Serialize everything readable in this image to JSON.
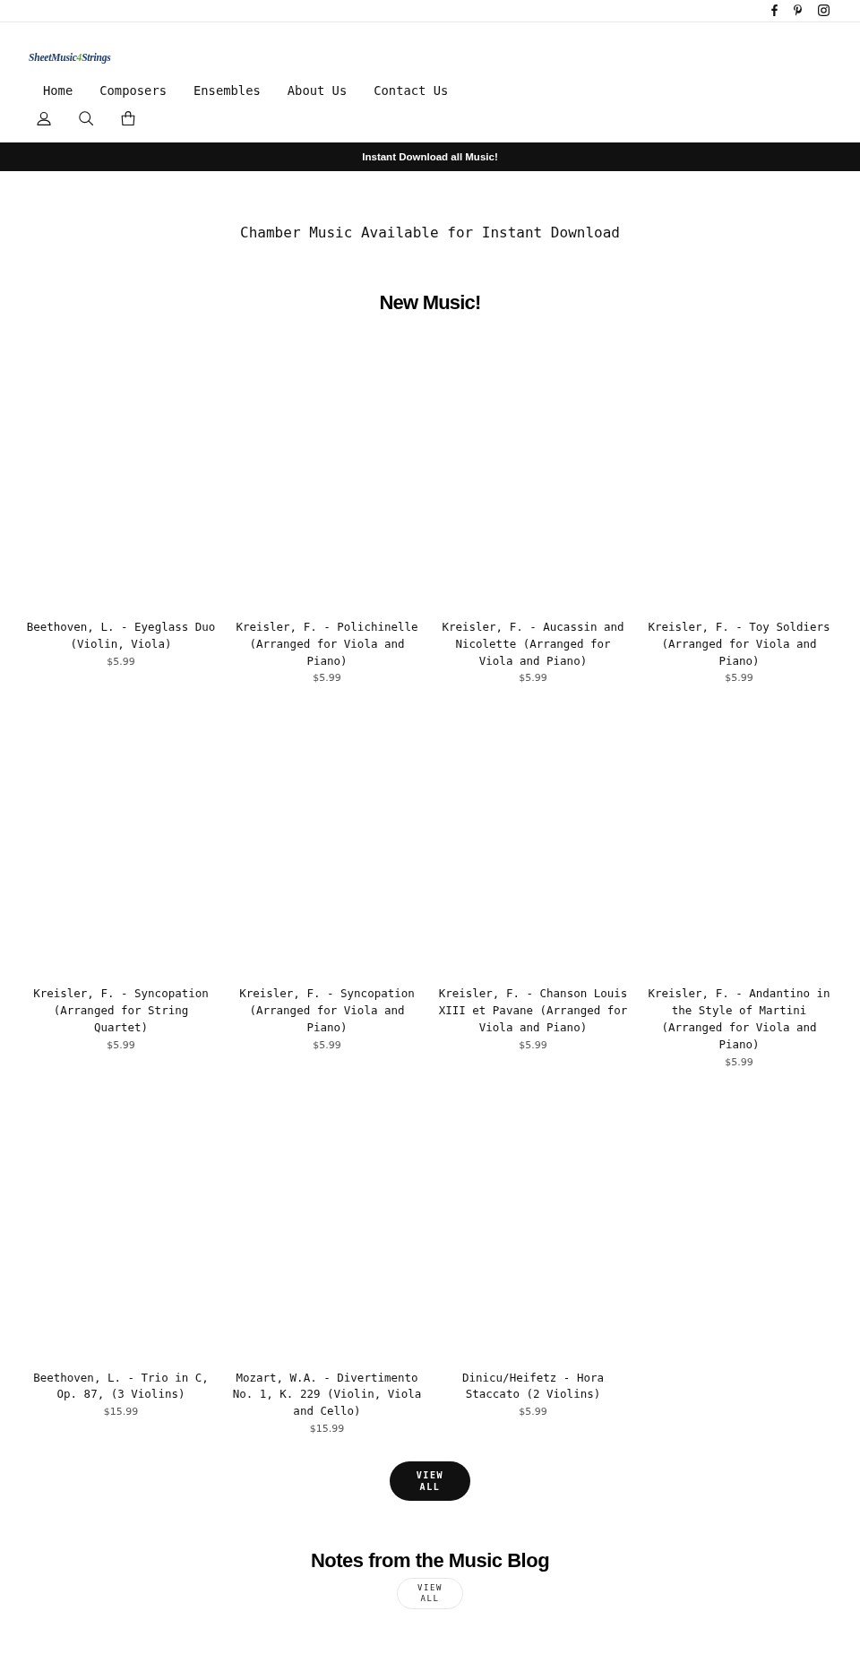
{
  "logo": {
    "segments": [
      {
        "text": "SheetMusic",
        "color": "#1d3b66"
      },
      {
        "text": "4",
        "color": "#6aaa3a"
      },
      {
        "text": "Strings",
        "color": "#1d3b66"
      }
    ]
  },
  "nav": [
    "Home",
    "Composers",
    "Ensembles",
    "About Us",
    "Contact Us"
  ],
  "announcement": "Instant Download all Music!",
  "tagline": "Chamber Music Available for Instant Download",
  "new_music": {
    "title": "New Music!",
    "products": [
      {
        "title": "Beethoven, L. - Eyeglass Duo (Violin, Viola)",
        "price": "$5.99"
      },
      {
        "title": "Kreisler, F. - Polichinelle (Arranged for Viola and Piano)",
        "price": "$5.99"
      },
      {
        "title": "Kreisler, F. - Aucassin and Nicolette (Arranged for Viola and Piano)",
        "price": "$5.99"
      },
      {
        "title": "Kreisler, F. - Toy Soldiers (Arranged for Viola and Piano)",
        "price": "$5.99"
      },
      {
        "title": "Kreisler, F. - Syncopation (Arranged for String Quartet)",
        "price": "$5.99"
      },
      {
        "title": "Kreisler, F. - Syncopation (Arranged for Viola and Piano)",
        "price": "$5.99"
      },
      {
        "title": "Kreisler, F. - Chanson Louis XIII et Pavane (Arranged for Viola and Piano)",
        "price": "$5.99"
      },
      {
        "title": "Kreisler, F. - Andantino in the Style of Martini (Arranged for Viola and Piano)",
        "price": "$5.99"
      },
      {
        "title": "Beethoven, L. - Trio in C, Op. 87, (3 Violins)",
        "price": "$15.99"
      },
      {
        "title": "Mozart, W.A. - Divertimento No. 1, K. 229 (Violin, Viola and Cello)",
        "price": "$15.99"
      },
      {
        "title": "Dinicu/Heifetz - Hora Staccato (2 Violins)",
        "price": "$5.99"
      }
    ],
    "button": "VIEW ALL"
  },
  "blog": {
    "title": "Notes from the Music Blog",
    "button": "VIEW ALL"
  }
}
